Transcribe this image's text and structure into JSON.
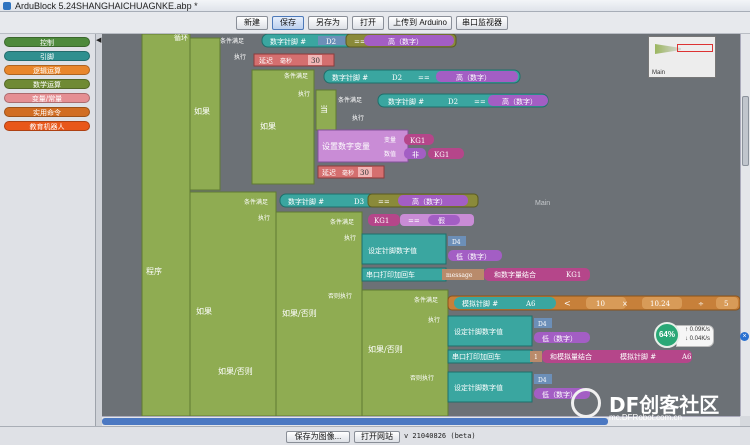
{
  "window": {
    "title": "ArduBlock 5.24SHANGHAICHUAGNKE.abp *"
  },
  "toolbar": {
    "buttons": [
      "新建",
      "保存",
      "另存为",
      "打开",
      "上传到 Arduino",
      "串口监视器"
    ]
  },
  "palette": {
    "categories": [
      {
        "label": "控制",
        "color": "#4e8a3b"
      },
      {
        "label": "引脚",
        "color": "#2f8f8f"
      },
      {
        "label": "逻辑运算",
        "color": "#e9862b"
      },
      {
        "label": "数学运算",
        "color": "#6f8a34"
      },
      {
        "label": "变量/常量",
        "color": "#e58f93"
      },
      {
        "label": "实用命令",
        "color": "#d16d23"
      },
      {
        "label": "教育机器人",
        "color": "#e8571a"
      }
    ]
  },
  "canvas": {
    "main_label": "Main",
    "minimap_label": "Main",
    "blocks": {
      "loop": "循环",
      "program": "程序",
      "if": "如果",
      "if_else": "如果/否则",
      "condition": "条件满足",
      "execute": "执行",
      "when": "当",
      "else_execute": "否则执行",
      "digital_read": "数字针脚 #",
      "analog_read": "模拟针脚 #",
      "pin_d2": "D2",
      "pin_d3": "D3",
      "pin_d4": "D4",
      "pin_a6": "A6",
      "equals": "==",
      "less_than": "<",
      "high": "高（数字）",
      "low": "低（数字）",
      "delay": "延迟",
      "millis": "毫秒",
      "delay_value": "30",
      "set_digital_var": "设置数字变量",
      "variable": "变量",
      "value": "数值",
      "not": "非",
      "kg1": "KG1",
      "false": "假",
      "set_pin_digital": "设定针脚数字值",
      "serial_println": "串口打印加回车",
      "message": "message",
      "join_digital": "和数字量结合",
      "join_analog": "和模拟量结合",
      "ten": "10",
      "multiply": "×",
      "num_1024": "10.24",
      "divide": "÷",
      "five": "5",
      "one": "1"
    }
  },
  "statusbar": {
    "buttons": [
      "保存为图像...",
      "打开网站"
    ],
    "version": "v 21040826 (beta)"
  },
  "net_widget": {
    "percent": "64%",
    "up": "0.09K/s",
    "down": "0.04K/s"
  },
  "watermark": {
    "brand": "DF创客社区",
    "url": "mc.DFRobot.com.cn"
  }
}
